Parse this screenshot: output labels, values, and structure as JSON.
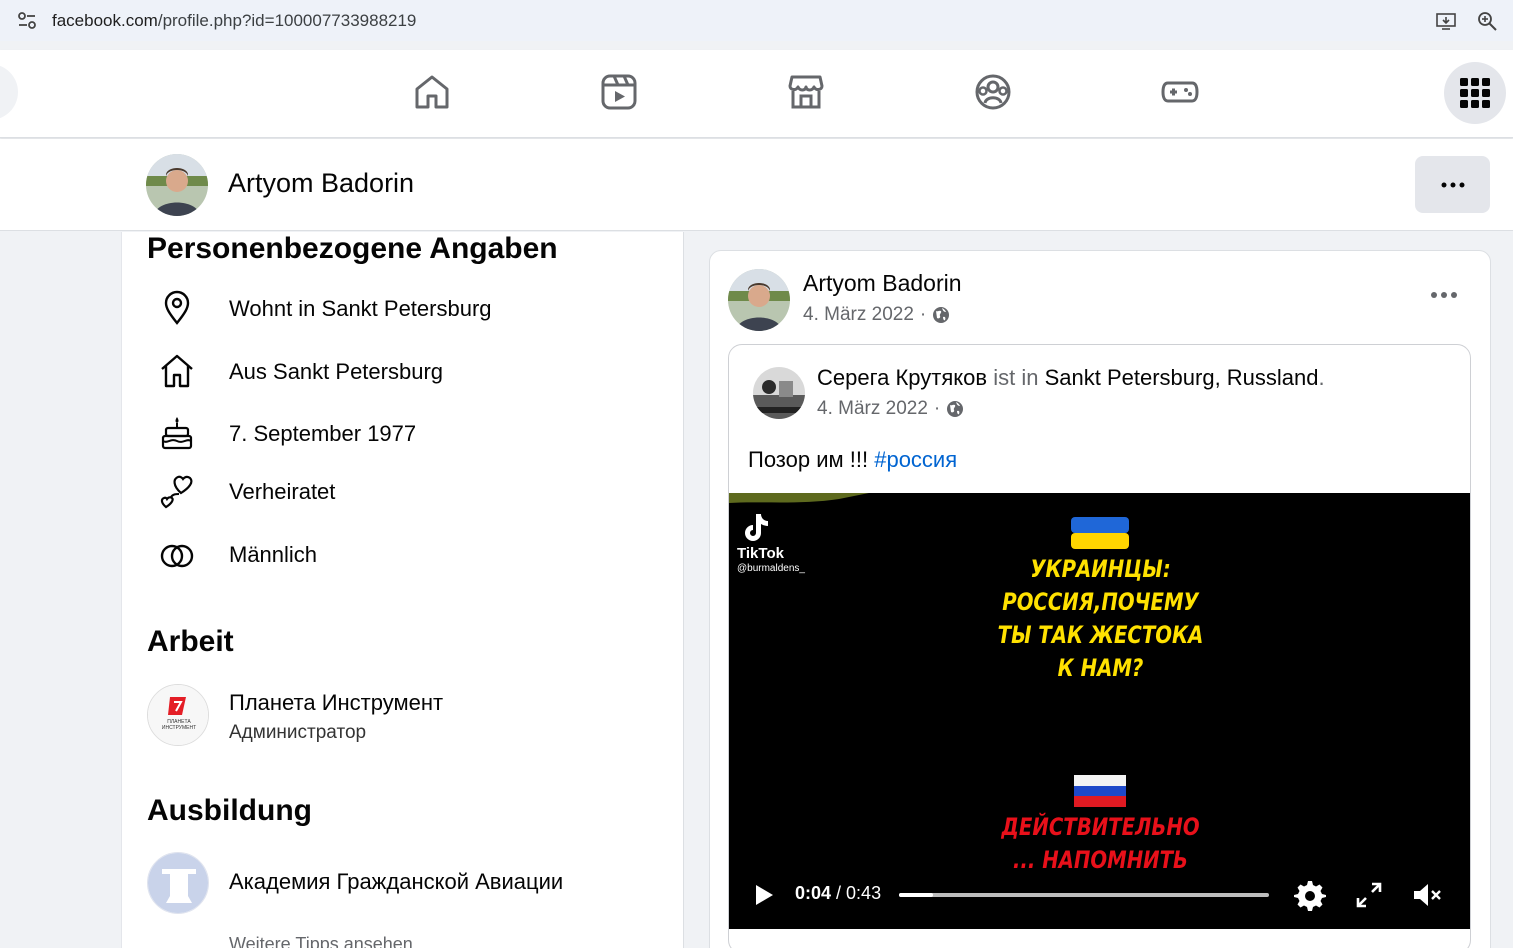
{
  "browser": {
    "url_domain": "facebook.com",
    "url_path": "/profile.php?id=100007733988219"
  },
  "profile": {
    "name": "Artyom Badorin"
  },
  "about": {
    "personal_title": "Personenbezogene Angaben",
    "items": [
      {
        "icon": "location-pin-icon",
        "text": "Wohnt in Sankt Petersburg"
      },
      {
        "icon": "home-icon",
        "text": "Aus Sankt Petersburg"
      },
      {
        "icon": "birthday-cake-icon",
        "text": "7. September 1977"
      },
      {
        "icon": "hearts-icon",
        "text": "Verheiratet"
      },
      {
        "icon": "gender-rings-icon",
        "text": "Männlich"
      }
    ],
    "work_title": "Arbeit",
    "work": {
      "name": "Планета Инструмент",
      "role": "Администратор"
    },
    "education_title": "Ausbildung",
    "education": {
      "name": "Академия Гражданской Авиации"
    },
    "more_tips": "Weitere Tipps ansehen"
  },
  "post": {
    "author": "Artyom Badorin",
    "date": "4. März 2022",
    "separator": "·",
    "shared": {
      "author": "Серега Крутяков",
      "is_in": "ist in",
      "location": "Sankt Petersburg, Russland",
      "period": ".",
      "date": "4. März 2022",
      "text": "Позор им !!!",
      "hashtag": "#россия"
    },
    "video": {
      "tiktok_name": "TikTok",
      "tiktok_handle": "@burmaldens_",
      "caption_top": [
        "УКРАИНЦЫ:",
        "РОССИЯ,ПОЧЕМУ",
        "ТЫ ТАК ЖЕСТОКА",
        "К НАМ?"
      ],
      "caption_bottom": [
        "ДЕЙСТВИТЕЛЬНО",
        "... НАПОМНИТЬ"
      ],
      "current_time": "0:04",
      "time_sep": " / ",
      "duration": "0:43",
      "progress": 0.093
    }
  }
}
